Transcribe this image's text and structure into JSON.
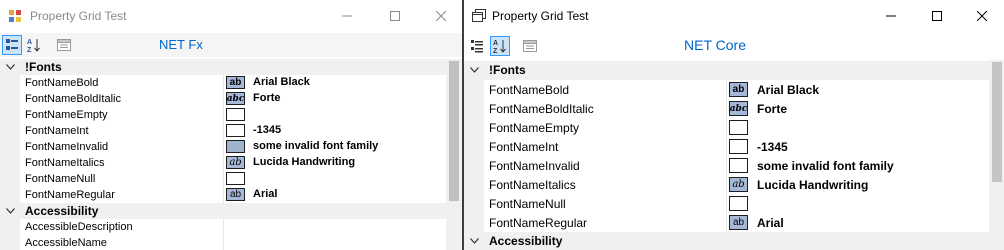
{
  "fx": {
    "title": "Property Grid Test",
    "toolbar_label": "NET Fx",
    "categories": [
      {
        "name": "!Fonts"
      },
      {
        "name": "Accessibility"
      }
    ],
    "font_props": [
      {
        "name": "FontNameBold",
        "value": "Arial Black",
        "preview": "ab",
        "swatch": "ab"
      },
      {
        "name": "FontNameBoldItalic",
        "value": "Forte",
        "preview": "abc",
        "swatch": "italic"
      },
      {
        "name": "FontNameEmpty",
        "value": "",
        "preview": "",
        "swatch": "empty"
      },
      {
        "name": "FontNameInt",
        "value": "-1345",
        "preview": "",
        "swatch": "empty"
      },
      {
        "name": "FontNameInvalid",
        "value": "some invalid font family",
        "preview": "",
        "swatch": "filled"
      },
      {
        "name": "FontNameItalics",
        "value": "Lucida Handwriting",
        "preview": "ab",
        "swatch": "script"
      },
      {
        "name": "FontNameNull",
        "value": "",
        "preview": "",
        "swatch": "empty"
      },
      {
        "name": "FontNameRegular",
        "value": "Arial",
        "preview": "ab",
        "swatch": "ab-plain"
      }
    ],
    "accessibility_props": [
      {
        "name": "AccessibleDescription",
        "value": ""
      },
      {
        "name": "AccessibleName",
        "value": ""
      }
    ]
  },
  "core": {
    "title": "Property Grid Test",
    "toolbar_label": "NET Core",
    "categories": [
      {
        "name": "!Fonts"
      },
      {
        "name": "Accessibility"
      }
    ],
    "font_props": [
      {
        "name": "FontNameBold",
        "value": "Arial Black",
        "preview": "ab",
        "swatch": "ab"
      },
      {
        "name": "FontNameBoldItalic",
        "value": "Forte",
        "preview": "abc",
        "swatch": "italic"
      },
      {
        "name": "FontNameEmpty",
        "value": "",
        "preview": "",
        "swatch": "empty"
      },
      {
        "name": "FontNameInt",
        "value": "-1345",
        "preview": "",
        "swatch": "empty"
      },
      {
        "name": "FontNameInvalid",
        "value": "some invalid font family",
        "preview": "",
        "swatch": "empty"
      },
      {
        "name": "FontNameItalics",
        "value": "Lucida Handwriting",
        "preview": "ab",
        "swatch": "script"
      },
      {
        "name": "FontNameNull",
        "value": "",
        "preview": "",
        "swatch": "empty"
      },
      {
        "name": "FontNameRegular",
        "value": "Arial",
        "preview": "ab",
        "swatch": "ab-plain"
      }
    ]
  },
  "colors": {
    "toolbar_label": "#0066cc",
    "category_bg": "#f0f0f0",
    "swatch_blue": "#a6b8d8",
    "swatch_filled": "#9fb3cf",
    "selected_toggle": "#cce4f7"
  }
}
